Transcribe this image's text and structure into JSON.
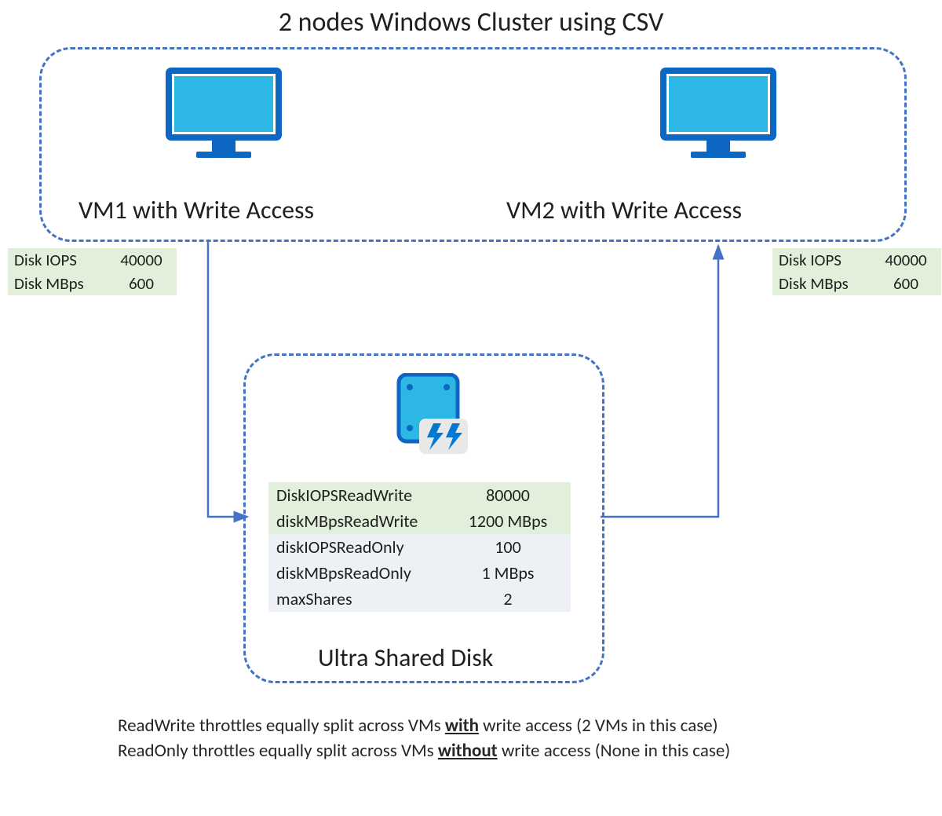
{
  "title": "2 nodes Windows Cluster using CSV",
  "vm1": {
    "label": "VM1 with Write Access",
    "disk": {
      "iops_label": "Disk IOPS",
      "iops_value": "40000",
      "mbps_label": "Disk MBps",
      "mbps_value": "600"
    }
  },
  "vm2": {
    "label": "VM2 with Write Access",
    "disk": {
      "iops_label": "Disk IOPS",
      "iops_value": "40000",
      "mbps_label": "Disk MBps",
      "mbps_value": "600"
    }
  },
  "ultra": {
    "label": "Ultra Shared Disk",
    "rows": [
      {
        "k": "DiskIOPSReadWrite",
        "v": "80000",
        "hl": "green"
      },
      {
        "k": "diskMBpsReadWrite",
        "v": "1200 MBps",
        "hl": "green"
      },
      {
        "k": "diskIOPSReadOnly",
        "v": "100",
        "hl": "grey"
      },
      {
        "k": "diskMBpsReadOnly",
        "v": "1 MBps",
        "hl": "grey"
      },
      {
        "k": "maxShares",
        "v": "2",
        "hl": "grey"
      }
    ]
  },
  "footnotes": {
    "line1_pre": "ReadWrite throttles equally split across VMs ",
    "line1_bold": "with",
    "line1_post": " write access (2 VMs in this case)",
    "line2_pre": "ReadOnly throttles equally split across VMs ",
    "line2_bold": "without",
    "line2_post": " write access (None in this case)"
  },
  "colors": {
    "border_blue": "#4472c4",
    "icon_teal": "#2cb7e5",
    "icon_blue": "#0d66c1",
    "bolt_blue": "#0078d4"
  }
}
